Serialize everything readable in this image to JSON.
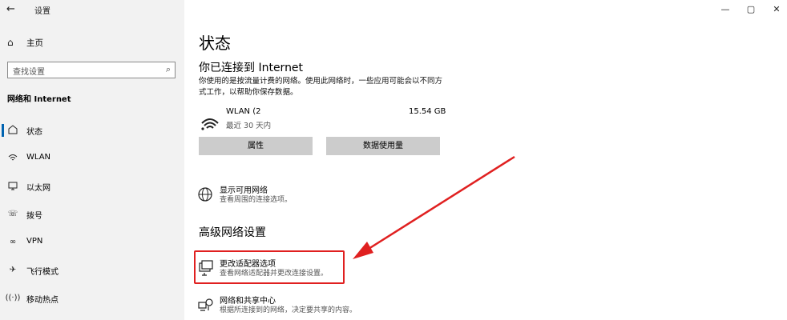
{
  "window": {
    "title": "设置",
    "controls": {
      "minimize": "—",
      "maximize": "▢",
      "close": "✕"
    }
  },
  "sidebar": {
    "home_label": "主页",
    "search_placeholder": "查找设置",
    "section_header": "网络和 Internet",
    "items": [
      {
        "label": "状态",
        "icon": "home-status-icon",
        "active": true
      },
      {
        "label": "WLAN",
        "icon": "wifi-icon"
      },
      {
        "label": "以太网",
        "icon": "ethernet-icon"
      },
      {
        "label": "拨号",
        "icon": "dialup-icon"
      },
      {
        "label": "VPN",
        "icon": "vpn-icon"
      },
      {
        "label": "飞行模式",
        "icon": "airplane-icon"
      },
      {
        "label": "移动热点",
        "icon": "hotspot-icon"
      }
    ]
  },
  "main": {
    "title": "状态",
    "connected_heading": "你已连接到 Internet",
    "description": "你使用的是按流量计费的网络。使用此网络时，一些应用可能会以不同方式工作，以帮助你保存数据。",
    "network": {
      "name": "WLAN (2",
      "subtitle": "最近 30 天内",
      "usage": "15.54 GB"
    },
    "buttons": {
      "properties": "属性",
      "data_usage": "数据使用量"
    },
    "show_networks": {
      "title": "显示可用网络",
      "subtitle": "查看周围的连接选项。"
    },
    "advanced_heading": "高级网络设置",
    "adapter_options": {
      "title": "更改适配器选项",
      "subtitle": "查看网络适配器并更改连接设置。"
    },
    "sharing_center": {
      "title": "网络和共享中心",
      "subtitle": "根据所连接到的网络，决定要共享的内容。"
    }
  },
  "colors": {
    "accent": "#0063b1",
    "annotation_red": "#e02020",
    "sidebar_bg": "#f2f2f2",
    "button_bg": "#cccccc"
  }
}
